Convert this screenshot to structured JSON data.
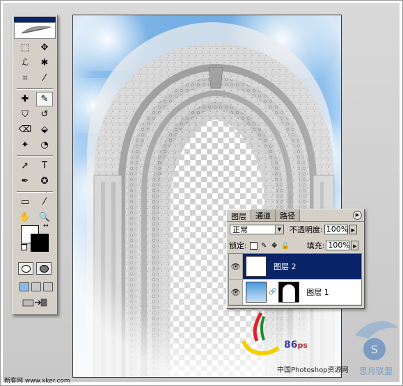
{
  "toolbox": {
    "tools": [
      [
        "marquee-tool",
        "move-tool"
      ],
      [
        "lasso-tool",
        "magic-wand-tool"
      ],
      [
        "crop-tool",
        "slice-tool"
      ],
      [
        "healing-brush-tool",
        "brush-tool"
      ],
      [
        "clone-stamp-tool",
        "history-brush-tool"
      ],
      [
        "eraser-tool",
        "paint-bucket-tool"
      ],
      [
        "blur-tool",
        "dodge-tool"
      ],
      [
        "path-selection-tool",
        "type-tool"
      ],
      [
        "pen-tool",
        "custom-shape-tool"
      ],
      [
        "notes-tool",
        "eyedropper-tool"
      ],
      [
        "hand-tool",
        "zoom-tool"
      ]
    ],
    "glyphs": [
      [
        "⬚",
        "✥"
      ],
      [
        "ℒ",
        "✱"
      ],
      [
        "⌗",
        "⁄"
      ],
      [
        "✚",
        "✎"
      ],
      [
        "⛉",
        "↺"
      ],
      [
        "⌫",
        "⬙"
      ],
      [
        "✦",
        "◔"
      ],
      [
        "➚",
        "T"
      ],
      [
        "✒",
        "✪"
      ],
      [
        "▭",
        "⁄"
      ],
      [
        "✋",
        "🔍"
      ]
    ],
    "type_label": "T"
  },
  "layers_panel": {
    "tabs": [
      "图层",
      "通道",
      "路径"
    ],
    "blend_mode": "正常",
    "opacity_label": "不透明度:",
    "opacity_value": "100%",
    "lock_label": "锁定:",
    "fill_label": "填充:",
    "fill_value": "100%",
    "layers": [
      {
        "name": "图层 2",
        "selected": true,
        "visible": true
      },
      {
        "name": "图层 1",
        "selected": false,
        "visible": true,
        "has_mask": true
      }
    ]
  },
  "watermarks": {
    "logo_text": "86",
    "logo_suffix": "ps",
    "site_text": "中国Photoshop资源网",
    "bottom_left": "新客网 www.xker.com",
    "badge_text": "思月联盟"
  },
  "colors": {
    "selection": "#0a246a",
    "panel_bg": "#d4d0c8",
    "sky": "#4b9be0"
  }
}
